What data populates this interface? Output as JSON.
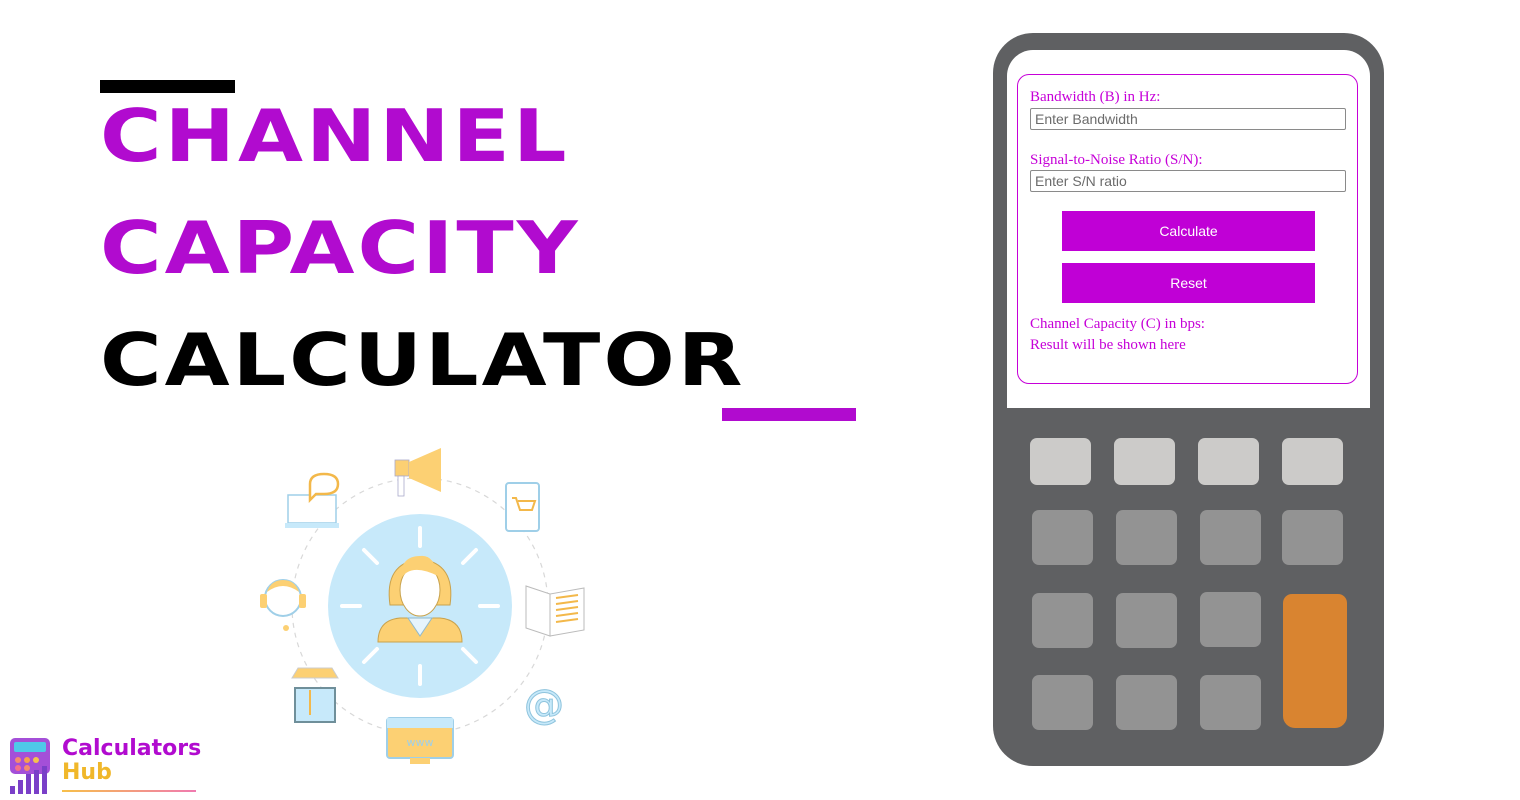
{
  "title": {
    "line1": "CHANNEL",
    "line2": "CAPACITY",
    "line3": "CALCULATOR"
  },
  "colors": {
    "accent": "#b10bcf",
    "form_accent": "#c600d8",
    "calculator_body": "#5f6062",
    "key_light": "#cccbc9",
    "key_gray": "#939393",
    "key_equals": "#d98430"
  },
  "calculator": {
    "bandwidth_label": "Bandwidth (B) in Hz:",
    "bandwidth_placeholder": "Enter Bandwidth",
    "bandwidth_value": "",
    "snr_label": "Signal-to-Noise Ratio (S/N):",
    "snr_placeholder": "Enter S/N ratio",
    "snr_value": "",
    "calculate_label": "Calculate",
    "reset_label": "Reset",
    "result_label": "Channel Capacity (C) in bps:",
    "result_text": "Result will be shown here"
  },
  "illustration": {
    "center": "person-icon",
    "orbit_icons": [
      "megaphone-icon",
      "tablet-cart-icon",
      "book-icon",
      "at-sign-icon",
      "web-store-icon",
      "shop-icon",
      "headset-icon",
      "laptop-chat-icon"
    ],
    "www_text": "www"
  },
  "logo": {
    "line1": "Calculators",
    "line2": "Hub"
  }
}
